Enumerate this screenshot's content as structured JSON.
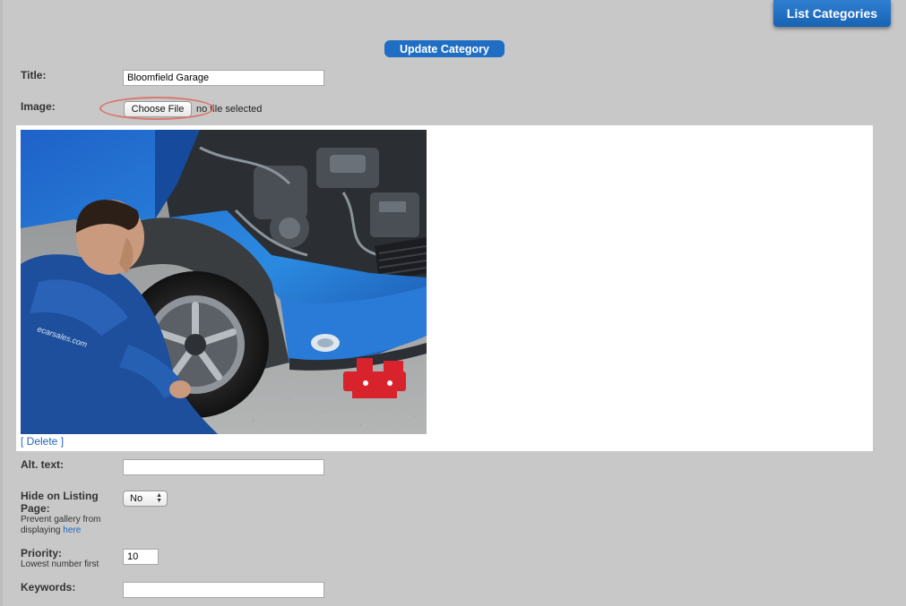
{
  "header": {
    "list_categories_label": "List Categories"
  },
  "form": {
    "update_button_label": "Update Category",
    "title_label": "Title:",
    "title_value": "Bloomfield Garage",
    "image_label": "Image:",
    "choose_file_label": "Choose File",
    "file_status": "no file selected",
    "delete_link": "[ Delete ]",
    "alt_text_label": "Alt. text:",
    "alt_text_value": "",
    "hide_label": "Hide on Listing Page:",
    "hide_note_prefix": "Prevent gallery from displaying",
    "hide_note_link": "here",
    "hide_value": "No",
    "priority_label": "Priority:",
    "priority_note": "Lowest number first",
    "priority_value": "10",
    "keywords_label": "Keywords:",
    "keywords_value": ""
  },
  "photo": {
    "shirt_text": "ecarsales.com"
  },
  "colors": {
    "background": "#c8c8c8",
    "button_blue": "#1f6ec4",
    "link_blue": "#2266bb",
    "highlight_ring": "#d9776b"
  }
}
